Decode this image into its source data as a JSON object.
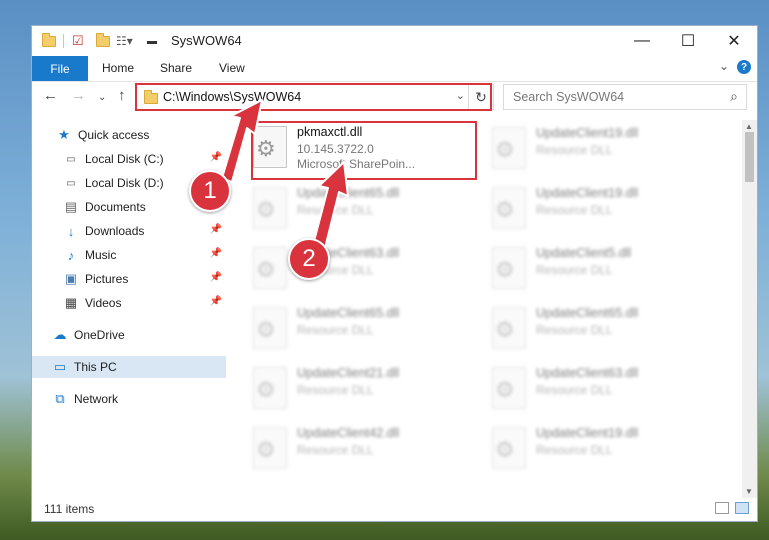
{
  "window": {
    "title": "SysWOW64",
    "controls": {
      "minimize": "—",
      "maximize": "☐",
      "close": "✕"
    }
  },
  "ribbon": {
    "file": "File",
    "tabs": [
      "Home",
      "Share",
      "View"
    ],
    "collapse_icon": "chevron-down-icon",
    "help": "?"
  },
  "address_bar": {
    "path": "C:\\Windows\\SysWOW64",
    "search_placeholder": "Search SysWOW64"
  },
  "nav_pane": {
    "quick_access": "Quick access",
    "items": [
      {
        "label": "Local Disk (C:)",
        "icon": "drive-icon",
        "pinned": true
      },
      {
        "label": "Local Disk (D:)",
        "icon": "drive-icon",
        "pinned": false
      },
      {
        "label": "Documents",
        "icon": "documents-icon",
        "pinned": true
      },
      {
        "label": "Downloads",
        "icon": "downloads-icon",
        "pinned": true
      },
      {
        "label": "Music",
        "icon": "music-icon",
        "pinned": true
      },
      {
        "label": "Pictures",
        "icon": "pictures-icon",
        "pinned": true
      },
      {
        "label": "Videos",
        "icon": "videos-icon",
        "pinned": true
      }
    ],
    "onedrive": "OneDrive",
    "this_pc": "This PC",
    "network": "Network"
  },
  "files": {
    "highlighted": {
      "name": "pkmaxctl.dll",
      "version": "10.145.3722.0",
      "description": "Microsoft SharePoin..."
    },
    "left_column": [
      {
        "name": "UpdateClient65.dll",
        "type": "Resource DLL"
      },
      {
        "name": "UpdateClient63.dll",
        "type": "Resource DLL"
      },
      {
        "name": "UpdateClient65.dll",
        "type": "Resource DLL"
      },
      {
        "name": "UpdateClient21.dll",
        "type": "Resource DLL"
      },
      {
        "name": "UpdateClient42.dll",
        "type": "Resource DLL"
      }
    ],
    "right_column": [
      {
        "name": "UpdateClient19.dll",
        "type": "Resource DLL"
      },
      {
        "name": "UpdateClient19.dll",
        "type": "Resource DLL"
      },
      {
        "name": "UpdateClient5.dll",
        "type": "Resource DLL"
      },
      {
        "name": "UpdateClient65.dll",
        "type": "Resource DLL"
      },
      {
        "name": "UpdateClient63.dll",
        "type": "Resource DLL"
      },
      {
        "name": "UpdateClient19.dll",
        "type": "Resource DLL"
      }
    ]
  },
  "status": {
    "item_count": "111 items"
  },
  "callouts": {
    "one": "1",
    "two": "2",
    "color": "#d9343e"
  }
}
